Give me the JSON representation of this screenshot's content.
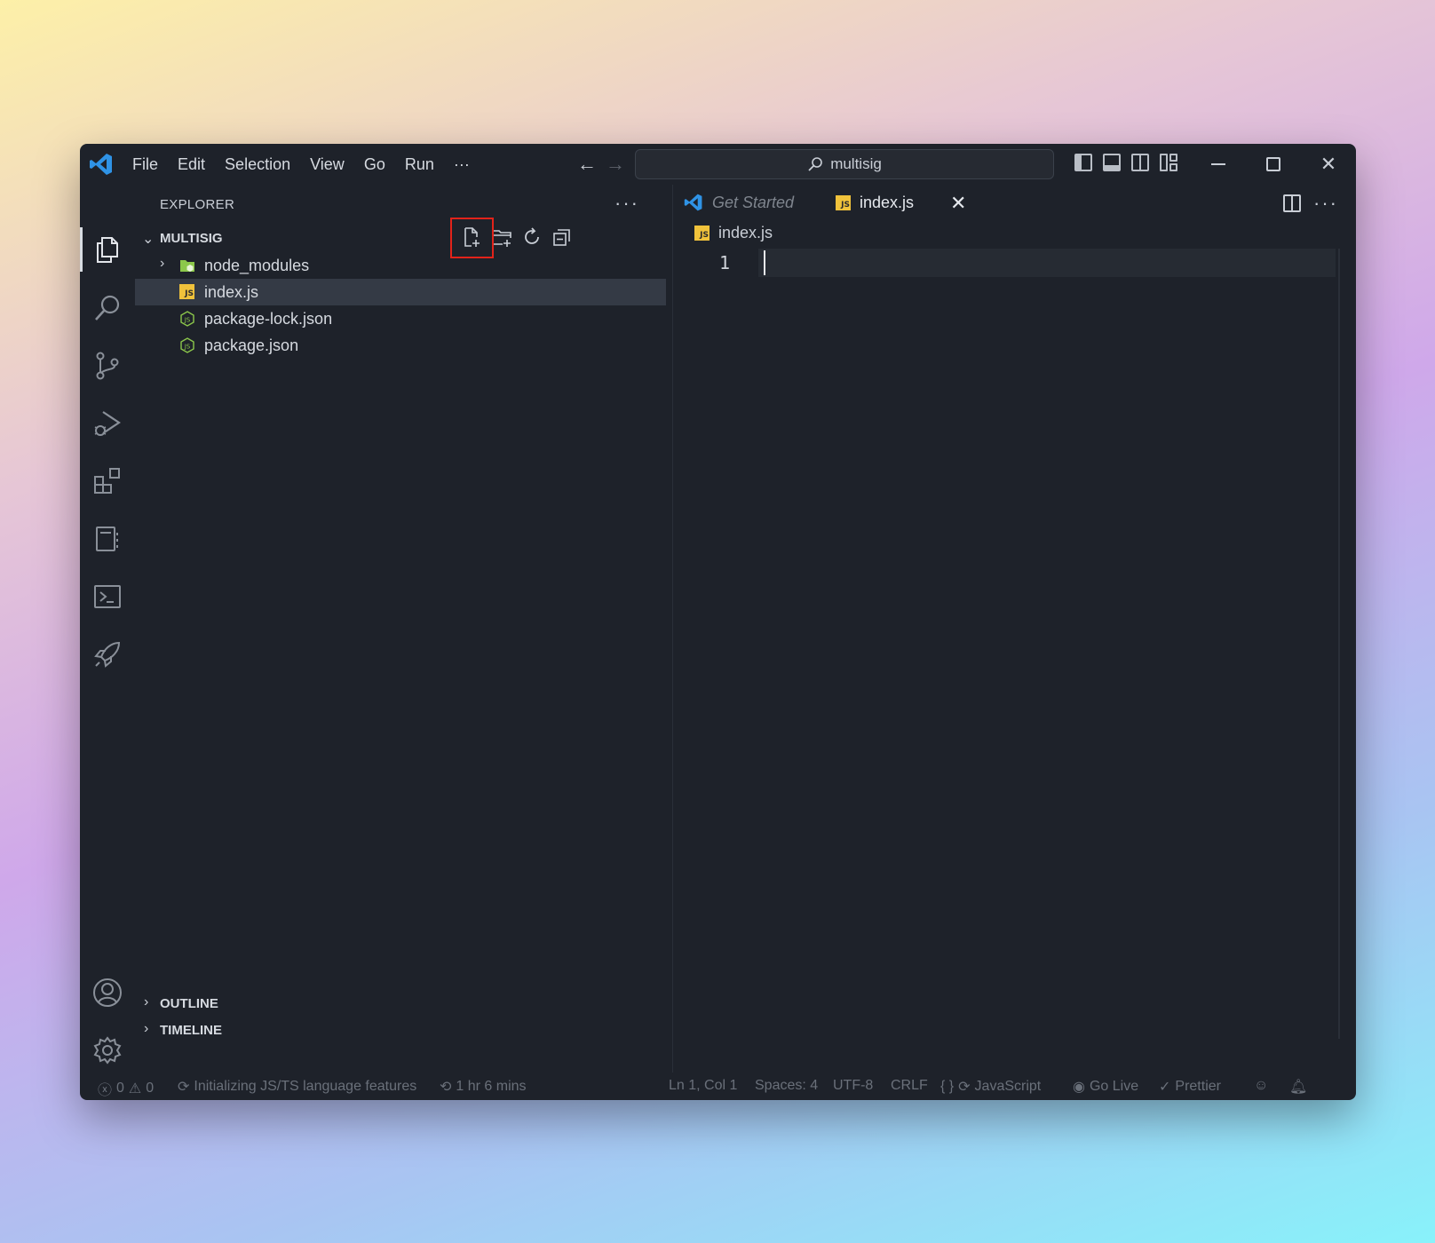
{
  "titlebar": {
    "menu": [
      "File",
      "Edit",
      "Selection",
      "View",
      "Go",
      "Run",
      "···"
    ],
    "search_text": "multisig"
  },
  "activity_bar": {
    "icons": [
      "explorer-icon",
      "search-icon",
      "source-control-icon",
      "run-debug-icon",
      "extensions-icon",
      "notebook-icon",
      "terminal-icon",
      "rocket-icon",
      "account-icon",
      "settings-gear-icon"
    ]
  },
  "sidebar": {
    "title": "EXPLORER",
    "more": "···",
    "folder": "MULTISIG",
    "files": [
      {
        "name": "node_modules",
        "type": "folder",
        "icon": "node-folder-icon"
      },
      {
        "name": "index.js",
        "type": "js",
        "icon": "js-file-icon",
        "selected": true
      },
      {
        "name": "package-lock.json",
        "type": "json",
        "icon": "node-json-icon"
      },
      {
        "name": "package.json",
        "type": "json",
        "icon": "node-json-icon"
      }
    ],
    "sections": [
      "OUTLINE",
      "TIMELINE"
    ]
  },
  "editor": {
    "tabs": [
      {
        "label": "Get Started",
        "active": false
      },
      {
        "label": "index.js",
        "active": true
      }
    ],
    "breadcrumb": "index.js",
    "line_number": "1",
    "js_badge": "JS"
  },
  "statusbar": {
    "errors": "0",
    "warnings": "0",
    "progress": "Initializing JS/TS language features",
    "time": "1 hr 6 mins",
    "position": "Ln 1, Col 1",
    "spaces": "Spaces: 4",
    "encoding": "UTF-8",
    "eol": "CRLF",
    "braces": "{ }",
    "language": "JavaScript",
    "go_live": "Go Live",
    "prettier": "Prettier"
  },
  "colors": {
    "accent_blue": "#2f93e6",
    "highlight_red": "#e2231a",
    "js_yellow": "#f0c23b",
    "node_green": "#8cc84b"
  }
}
